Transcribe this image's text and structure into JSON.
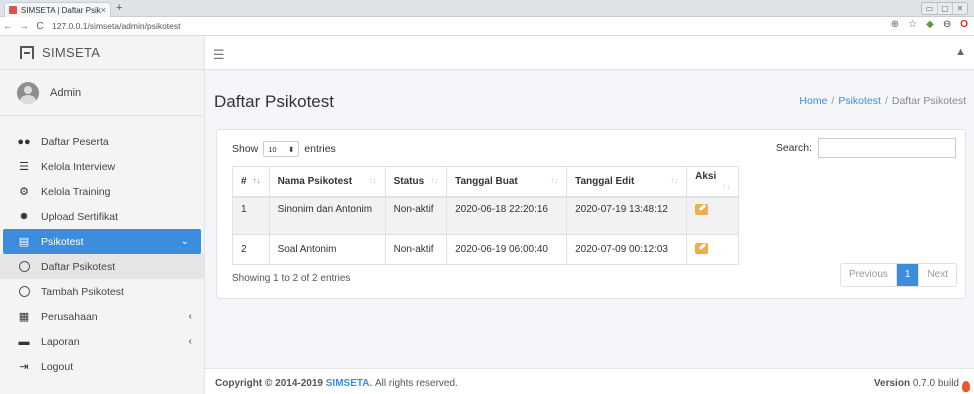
{
  "browser": {
    "tab_title": "SIMSETA | Daftar Psikotest",
    "tab_close": "×",
    "new_tab": "+",
    "url": "127.0.0.1/simseta/admin/psikotest",
    "window_controls": [
      "▭",
      "▢",
      "✕"
    ]
  },
  "brand": {
    "name": "SIMSETA"
  },
  "user": {
    "name": "Admin"
  },
  "sidebar": {
    "items": [
      {
        "label": "Daftar Peserta",
        "icon": "users-icon"
      },
      {
        "label": "Kelola Interview",
        "icon": "list-icon"
      },
      {
        "label": "Kelola Training",
        "icon": "cogs-icon"
      },
      {
        "label": "Upload Sertifikat",
        "icon": "certificate-icon"
      },
      {
        "label": "Psikotest",
        "icon": "form-icon",
        "active": true
      },
      {
        "label": "Daftar Psikotest",
        "icon": "circle-icon",
        "sub": true,
        "selected": true
      },
      {
        "label": "Tambah Psikotest",
        "icon": "circle-icon",
        "sub": true
      },
      {
        "label": "Perusahaan",
        "icon": "building-icon"
      },
      {
        "label": "Laporan",
        "icon": "file-icon"
      },
      {
        "label": "Logout",
        "icon": "sign-out-icon"
      }
    ]
  },
  "page": {
    "title": "Daftar Psikotest",
    "breadcrumb": [
      "Home",
      "Psikotest",
      "Daftar Psikotest"
    ]
  },
  "table": {
    "show_label": "Show",
    "entries_value": "10",
    "entries_label": "entries",
    "search_label": "Search:",
    "columns": [
      "#",
      "Nama Psikotest",
      "Status",
      "Tanggal Buat",
      "Tanggal Edit",
      "Aksi"
    ],
    "rows": [
      {
        "no": "1",
        "nama": "Sinonim dan Antonim",
        "status": "Non-aktif",
        "buat": "2020-06-18 22:20:16",
        "edit": "2020-07-19 13:48:12"
      },
      {
        "no": "2",
        "nama": "Soal Antonim",
        "status": "Non-aktif",
        "buat": "2020-06-19 06:00:40",
        "edit": "2020-07-09 00:12:03"
      }
    ],
    "info": "Showing 1 to 2 of 2 entries",
    "pager": {
      "prev": "Previous",
      "page": "1",
      "next": "Next"
    }
  },
  "footer": {
    "copyright_prefix": "Copyright © 2014-2019",
    "brand": "SIMSETA.",
    "rights": "All rights reserved.",
    "version_label": "Version",
    "version_value": "0.7.0 build"
  },
  "colors": {
    "accent": "#3c8dde",
    "edit_button": "#f0ad4e",
    "favicon": "#d9534f"
  }
}
